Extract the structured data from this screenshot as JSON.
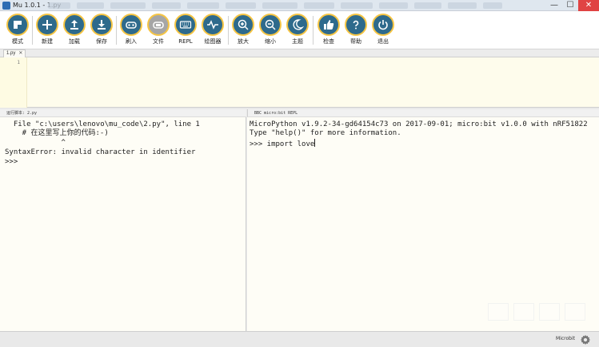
{
  "window": {
    "title": "Mu 1.0.1 - 1.py",
    "minimize": "—",
    "maximize": "☐",
    "close": "✕"
  },
  "toolbar": {
    "buttons": [
      {
        "id": "mode",
        "label": "模式",
        "icon": "mode-icon"
      },
      {
        "id": "new",
        "label": "新建",
        "icon": "plus-icon"
      },
      {
        "id": "load",
        "label": "加载",
        "icon": "upload-icon"
      },
      {
        "id": "save",
        "label": "保存",
        "icon": "download-icon"
      },
      {
        "id": "flash",
        "label": "刷入",
        "icon": "flash-icon"
      },
      {
        "id": "files",
        "label": "文件",
        "icon": "files-icon"
      },
      {
        "id": "repl",
        "label": "REPL",
        "icon": "keyboard-icon"
      },
      {
        "id": "plotter",
        "label": "绘图器",
        "icon": "pulse-icon"
      },
      {
        "id": "zoom-in",
        "label": "放大",
        "icon": "zoom-in-icon"
      },
      {
        "id": "zoom-out",
        "label": "缩小",
        "icon": "zoom-out-icon"
      },
      {
        "id": "theme",
        "label": "主题",
        "icon": "moon-icon"
      },
      {
        "id": "check",
        "label": "检查",
        "icon": "thumbs-up-icon"
      },
      {
        "id": "help",
        "label": "帮助",
        "icon": "question-icon"
      },
      {
        "id": "quit",
        "label": "退出",
        "icon": "power-icon"
      }
    ]
  },
  "tabs": [
    {
      "label": "1.py",
      "close": "✕"
    }
  ],
  "editor": {
    "line_numbers": [
      "1"
    ]
  },
  "run_pane": {
    "header": "运行脚本: 2.py",
    "lines": [
      "  File \"c:\\users\\lenovo\\mu_code\\2.py\", line 1",
      "    # 在这里写上你的代码:-)",
      "             ^",
      "SyntaxError: invalid character in identifier",
      ">>>"
    ]
  },
  "repl_pane": {
    "header": "BBC micro:bit REPL",
    "lines": [
      "MicroPython v1.9.2-34-gd64154c73 on 2017-09-01; micro:bit v1.0.0 with nRF51822",
      "Type \"help()\" for more information."
    ],
    "prompt_input": ">>> import love"
  },
  "status": {
    "mode": "Microbit",
    "gear_icon": "gear-icon"
  },
  "colors": {
    "button_fill": "#2e6a8c",
    "button_ring": "#f6c544",
    "editor_bg": "#fefcec",
    "pane_bg": "#fefdf6"
  }
}
